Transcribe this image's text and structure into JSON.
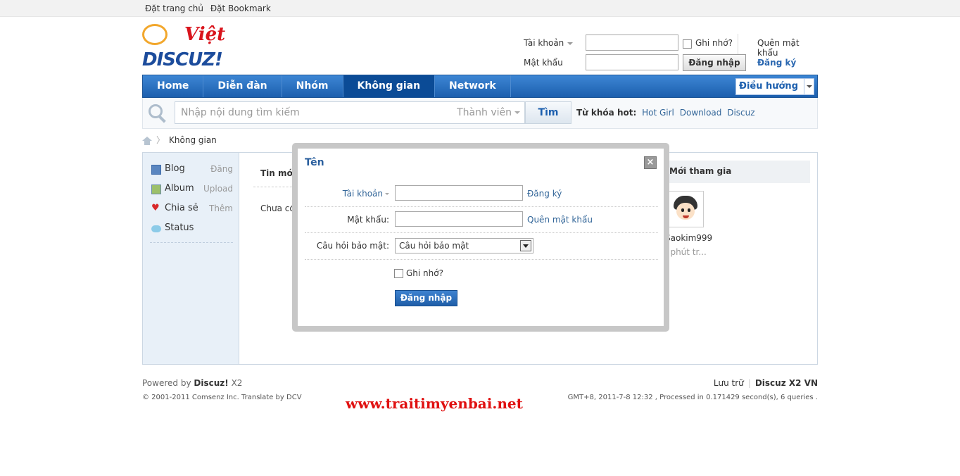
{
  "topbar": {
    "links": [
      "Đặt trang chủ",
      "Đặt Bookmark"
    ]
  },
  "logo": {
    "brand": "DISCUZ!",
    "tag": "Việt"
  },
  "login": {
    "account_label": "Tài khoản",
    "password_label": "Mật khẩu",
    "remember_label": "Ghi nhớ?",
    "submit_label": "Đăng nhập",
    "forgot_label": "Quên mật khẩu",
    "register_label": "Đăng ký"
  },
  "nav": {
    "items": [
      {
        "label": "Home"
      },
      {
        "label": "Diễn đàn"
      },
      {
        "label": "Nhóm"
      },
      {
        "label": "Không gian"
      },
      {
        "label": "Network"
      }
    ],
    "active_index": 3,
    "right_label": "Điều hướng"
  },
  "search": {
    "placeholder": "Nhập nội dung tìm kiếm",
    "mode": "Thành viên",
    "button": "Tìm",
    "hot_label": "Từ khóa hot:",
    "hot_links": [
      "Hot Girl",
      "Download",
      "Discuz"
    ]
  },
  "breadcrumb": {
    "current": "Không gian"
  },
  "sidebar": {
    "items": [
      {
        "label": "Blog",
        "action": "Đăng",
        "icon": "blog-icon"
      },
      {
        "label": "Album",
        "action": "Upload",
        "icon": "album-icon"
      },
      {
        "label": "Chia sẻ",
        "action": "Thêm",
        "icon": "share-icon"
      },
      {
        "label": "Status",
        "action": "",
        "icon": "status-icon"
      }
    ]
  },
  "content": {
    "title": "Tin mới n",
    "empty": "Chưa có t"
  },
  "new_members": {
    "title": "Mới tham gia",
    "member_name": "Saokim999",
    "member_time": "5  phút tr..."
  },
  "footer": {
    "powered_prefix": "Powered by",
    "powered_brand": "Discuz!",
    "powered_version": "X2",
    "copyright": "© 2001-2011 Comsenz Inc. Translate by DCV",
    "archive": "Lưu trữ",
    "version_label": "Discuz X2 VN",
    "processed": "GMT+8, 2011-7-8 12:32 , Processed in 0.171429 second(s), 6 queries ."
  },
  "watermark": "www.traitimyenbai.net",
  "modal": {
    "title": "Tên",
    "account_label": "Tài khoản",
    "register_link": "Đăng ký",
    "password_label": "Mật khẩu:",
    "forgot_link": "Quên mật khẩu",
    "question_label": "Câu hỏi bảo mật:",
    "question_value": "Câu hỏi bảo mật",
    "remember_label": "Ghi nhớ?",
    "submit_label": "Đăng nhập"
  },
  "colors": {
    "nav_blue": "#1c5fae",
    "link_blue": "#336699",
    "watermark_red": "#e01010"
  }
}
